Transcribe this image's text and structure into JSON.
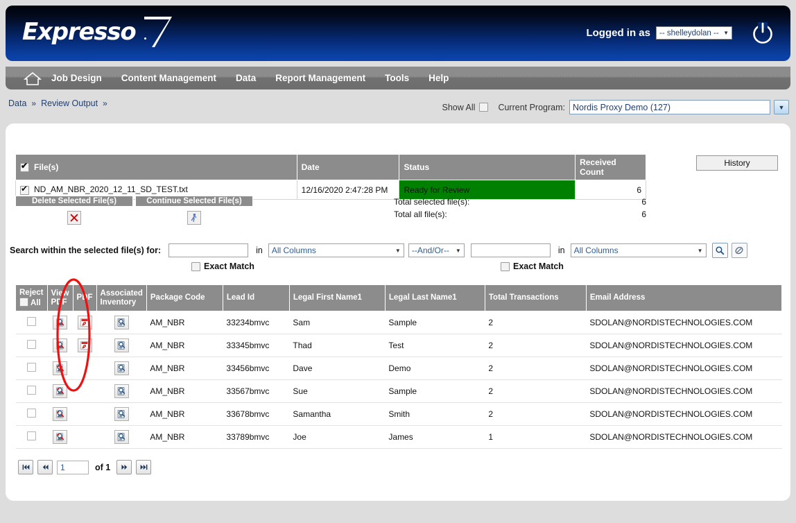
{
  "header": {
    "logo_text": "Expresso",
    "logged_in_label": "Logged in as",
    "user_value": "-- shelleydolan --",
    "caret": "▼",
    "power_icon": "power-icon"
  },
  "nav": {
    "home_icon": "home-icon",
    "items": [
      {
        "label": "Job Design"
      },
      {
        "label": "Content Management"
      },
      {
        "label": "Data"
      },
      {
        "label": "Report Management"
      },
      {
        "label": "Tools"
      },
      {
        "label": "Help"
      }
    ]
  },
  "breadcrumb": {
    "items": [
      "Data",
      "Review Output"
    ],
    "separator": "»"
  },
  "program_bar": {
    "show_all_label": "Show All",
    "show_all_checked": false,
    "current_program_label": "Current Program:",
    "current_program_value": "Nordis Proxy Demo (127)",
    "dropdown_caret": "▼"
  },
  "files": {
    "history_button": "History",
    "headers": [
      "File(s)",
      "Date",
      "Status",
      "Received Count"
    ],
    "select_all_checked": true,
    "rows": [
      {
        "checked": true,
        "name": "ND_AM_NBR_2020_12_11_SD_TEST.txt",
        "date": "12/16/2020 2:47:28 PM",
        "status": "Ready for Review",
        "status_color": "#008000",
        "received_count": "6"
      }
    ],
    "actions": [
      {
        "label": "Delete Selected File(s)",
        "icon": "delete-x-icon"
      },
      {
        "label": "Continue Selected File(s)",
        "icon": "runner-icon"
      }
    ],
    "totals": [
      {
        "label": "Total selected file(s):",
        "value": "6"
      },
      {
        "label": "Total all file(s):",
        "value": "6"
      }
    ]
  },
  "search": {
    "label": "Search within the selected file(s) for:",
    "term1": "",
    "term1_placeholder": "",
    "in_word": "in",
    "column1": "All Columns",
    "andor": "--And/Or--",
    "term2": "",
    "term2_placeholder": "",
    "column2": "All Columns",
    "exact_match_label": "Exact Match",
    "exact_match_1_checked": false,
    "exact_match_2_checked": false,
    "search_icon": "magnifier-icon",
    "clear_icon": "eraser-icon",
    "caret": "▼"
  },
  "grid": {
    "headers": [
      "Reject",
      "View PDF",
      "PDF",
      "Associated Inventory",
      "Package Code",
      "Lead Id",
      "Legal First Name1",
      "Legal Last Name1",
      "Total Transactions",
      "Email Address"
    ],
    "reject_all_label": "All",
    "reject_all_checked": false,
    "rows": [
      {
        "reject": false,
        "view_pdf": true,
        "pdf": true,
        "assoc_inventory": true,
        "package_code": "AM_NBR",
        "lead_id": "33234bmvc",
        "first_name": "Sam",
        "last_name": "Sample",
        "total_transactions": "2",
        "email": "SDOLAN@NORDISTECHNOLOGIES.COM"
      },
      {
        "reject": false,
        "view_pdf": true,
        "pdf": true,
        "assoc_inventory": true,
        "package_code": "AM_NBR",
        "lead_id": "33345bmvc",
        "first_name": "Thad",
        "last_name": "Test",
        "total_transactions": "2",
        "email": "SDOLAN@NORDISTECHNOLOGIES.COM"
      },
      {
        "reject": false,
        "view_pdf": true,
        "pdf": false,
        "assoc_inventory": true,
        "package_code": "AM_NBR",
        "lead_id": "33456bmvc",
        "first_name": "Dave",
        "last_name": "Demo",
        "total_transactions": "2",
        "email": "SDOLAN@NORDISTECHNOLOGIES.COM"
      },
      {
        "reject": false,
        "view_pdf": true,
        "pdf": false,
        "assoc_inventory": true,
        "package_code": "AM_NBR",
        "lead_id": "33567bmvc",
        "first_name": "Sue",
        "last_name": "Sample",
        "total_transactions": "2",
        "email": "SDOLAN@NORDISTECHNOLOGIES.COM"
      },
      {
        "reject": false,
        "view_pdf": true,
        "pdf": false,
        "assoc_inventory": true,
        "package_code": "AM_NBR",
        "lead_id": "33678bmvc",
        "first_name": "Samantha",
        "last_name": "Smith",
        "total_transactions": "2",
        "email": "SDOLAN@NORDISTECHNOLOGIES.COM"
      },
      {
        "reject": false,
        "view_pdf": true,
        "pdf": false,
        "assoc_inventory": true,
        "package_code": "AM_NBR",
        "lead_id": "33789bmvc",
        "first_name": "Joe",
        "last_name": "James",
        "total_transactions": "1",
        "email": "SDOLAN@NORDISTECHNOLOGIES.COM"
      }
    ]
  },
  "pager": {
    "first_icon": "first-page-icon",
    "prev_icon": "prev-page-icon",
    "page_value": "1",
    "of_label": "of 1",
    "next_icon": "next-page-icon",
    "last_icon": "last-page-icon"
  },
  "annotation": {
    "shape": "ellipse",
    "color": "#ee1111"
  },
  "colors": {
    "header_blue": "#0b44ac",
    "nav_gray": "#8c8c8c",
    "status_green": "#008000",
    "page_bg": "#dddddd",
    "annotation_red": "#ee1111"
  }
}
